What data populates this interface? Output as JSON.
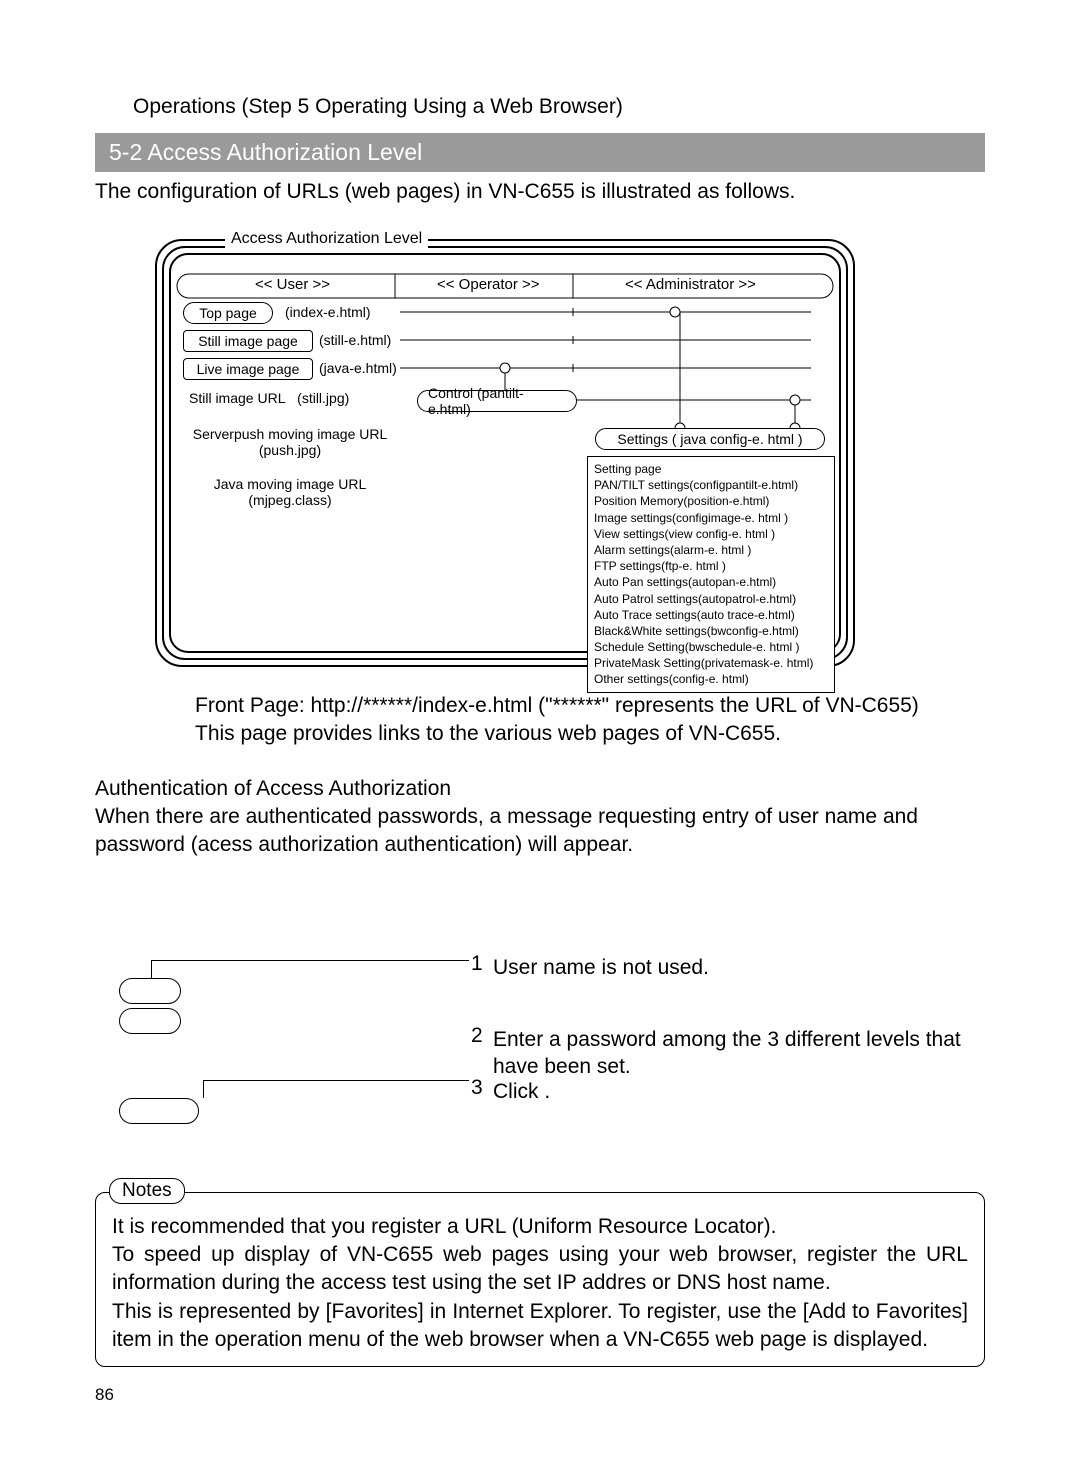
{
  "breadcrumb": "Operations (Step 5 Operating Using a Web Browser)",
  "section_title": "5-2 Access Authorization Level",
  "intro": "The configuration of URLs (web pages) in VN-C655 is illustrated as follows.",
  "diagram": {
    "title": "Access Authorization Level",
    "col_user": "<< User >>",
    "col_operator": "<< Operator >>",
    "col_admin": "<< Administrator   >>",
    "top_page": "Top page",
    "top_page_file": "(index-e.html)",
    "still_page": "Still image page",
    "still_page_file": "(still-e.html)",
    "live_page": "Live image page",
    "live_page_file": "(java-e.html)",
    "still_url": "Still image URL",
    "still_url_file": "(still.jpg)",
    "control_label": "Control (pantilt-e.html)",
    "serverpush_l1": "Serverpush moving image URL",
    "serverpush_l2": "(push.jpg)",
    "java_l1": "Java moving image URL",
    "java_l2": "(mjpeg.class)",
    "settings_label": "Settings ( java config-e. html )",
    "settings_header": "Setting page",
    "settings_items": [
      "PAN/TILT settings(configpantilt-e.html)",
      "Position Memory(position-e.html)",
      "Image settings(configimage-e. html )",
      "View settings(view config-e. html )",
      "Alarm settings(alarm-e. html )",
      "FTP settings(ftp-e. html )",
      "Auto Pan settings(autopan-e.html)",
      "Auto Patrol settings(autopatrol-e.html)",
      "Auto Trace settings(auto trace-e.html)",
      "Black&White settings(bwconfig-e.html)",
      "Schedule Setting(bwschedule-e. html )",
      "PrivateMask Setting(privatemask-e. html)",
      "Other settings(config-e. html)"
    ]
  },
  "front_page_l1": "Front Page: http://******/index-e.html (\"******\" represents the URL of VN-C655)",
  "front_page_l2": "This page provides links to the various web pages of VN-C655.",
  "auth_heading": "Authentication of Access Authorization",
  "auth_body": "When there are authenticated passwords, a message requesting entry of user name and password (acess authorization authentication) will appear.",
  "steps": {
    "n1": "1",
    "t1": "User name is not used.",
    "n2": "2",
    "t2": "Enter a password among the 3 different levels that have been set.",
    "n3": "3",
    "t3": "Click               ."
  },
  "notes": {
    "label": "Notes",
    "l1": "It is recommended that you register a URL (Uniform Resource Locator).",
    "l2": "To speed up display of VN-C655 web pages using your web browser, register the URL information during the access test using the set IP addres or DNS host name.",
    "l3": "This is represented by [Favorites] in Internet Explorer. To register, use the [Add to Favorites] item in the operation menu of the web browser when a VN-C655 web page is displayed."
  },
  "page_number": "86"
}
